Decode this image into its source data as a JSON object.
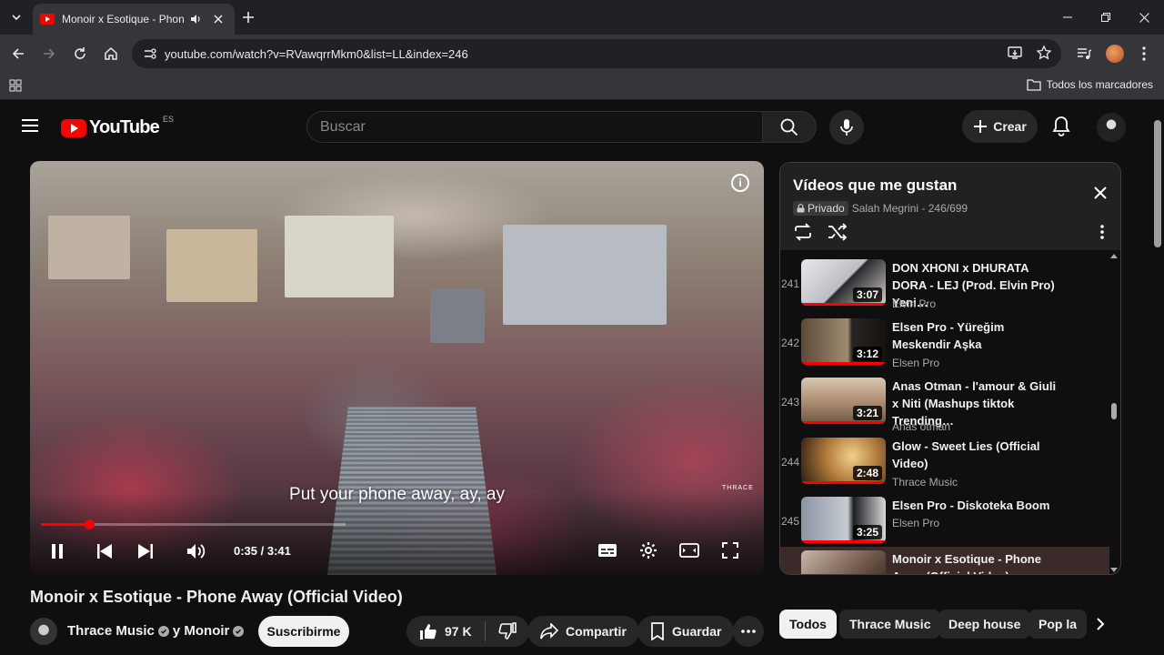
{
  "browser": {
    "tab_title": "Monoir x Esotique - Phone",
    "url_host": "youtube.com",
    "url_path": "/watch?v=RVawqrrMkm0&list=LL&index=246",
    "all_bookmarks_label": "Todos los marcadores"
  },
  "masthead": {
    "logo_text": "YouTube",
    "region": "ES",
    "search_placeholder": "Buscar",
    "create_label": "Crear"
  },
  "player": {
    "caption": "Put your phone away, ay, ay",
    "watermark": "THRACE",
    "current_time": "0:35",
    "duration": "3:41",
    "time_display": "0:35 / 3:41",
    "progress_fraction": 0.158,
    "is_playing": true
  },
  "video": {
    "title": "Monoir x Esotique - Phone Away (Official Video)",
    "channel": "Thrace Music",
    "collab_text": "y Monoir",
    "subscribe_label": "Suscribirme",
    "likes": "97 K",
    "share_label": "Compartir",
    "save_label": "Guardar"
  },
  "playlist": {
    "title": "Vídeos que me gustan",
    "privacy": "Privado",
    "owner_position": "Salah Megrini - 246/699",
    "items": [
      {
        "index": "241",
        "title": "DON XHONI x DHURATA DORA - LEJ (Prod. Elvin Pro) Yeni…",
        "channel": "Elvin Pro",
        "duration": "3:07"
      },
      {
        "index": "242",
        "title": "Elsen Pro - Yüreğim Meskendir Aşka",
        "channel": "Elsen Pro",
        "duration": "3:12"
      },
      {
        "index": "243",
        "title": "Anas Otman - l'amour & Giuli x Niti (Mashups tiktok Trending…",
        "channel": "Anas otman",
        "duration": "3:21"
      },
      {
        "index": "244",
        "title": "Glow - Sweet Lies (Official Video)",
        "channel": "Thrace Music",
        "duration": "2:48"
      },
      {
        "index": "245",
        "title": "Elsen Pro - Diskoteka Boom",
        "channel": "Elsen Pro",
        "duration": "3:25"
      },
      {
        "index": "",
        "title": "Monoir x Esotique - Phone Away (Official Video)",
        "channel": "",
        "duration": ""
      }
    ]
  },
  "chips": [
    "Todos",
    "Thrace Music",
    "Deep house",
    "Pop la"
  ],
  "colors": {
    "accent": "#ff0000",
    "background": "#0f0f0f",
    "surface": "#272727",
    "text": "#f1f1f1",
    "secondary_text": "#aaaaaa"
  }
}
